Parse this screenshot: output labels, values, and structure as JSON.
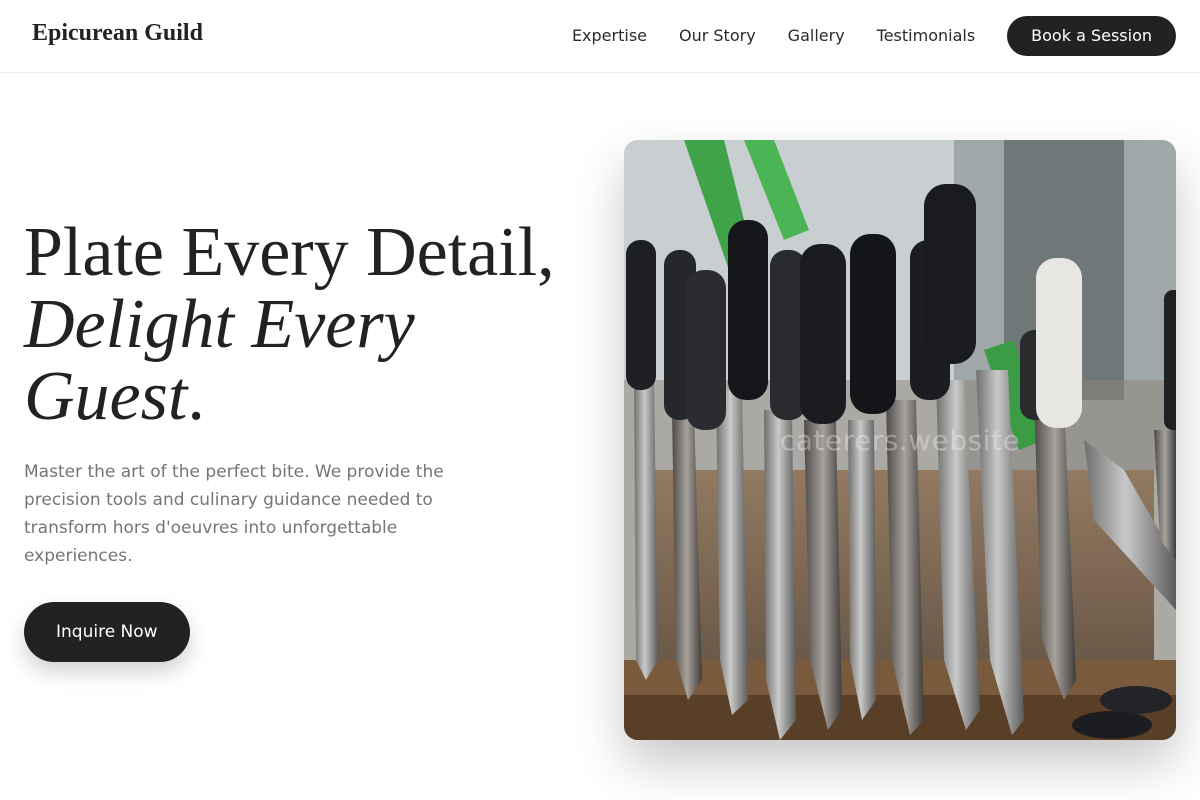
{
  "header": {
    "brand": "Epicurean Guild",
    "nav": [
      "Expertise",
      "Our Story",
      "Gallery",
      "Testimonials"
    ],
    "cta_label": "Book a Session"
  },
  "hero": {
    "title_line1": "Plate Every Detail,",
    "title_accent": "Delight Every Guest",
    "title_end": ".",
    "description": "Master the art of the perfect bite. We provide the precision tools and culinary guidance needed to transform hors d'oeuvres into unforgettable experiences.",
    "button_label": "Inquire Now",
    "image_watermark": "caterers.website"
  },
  "colors": {
    "primary_dark": "#222222",
    "body_text": "#757575",
    "background": "#ffffff"
  }
}
